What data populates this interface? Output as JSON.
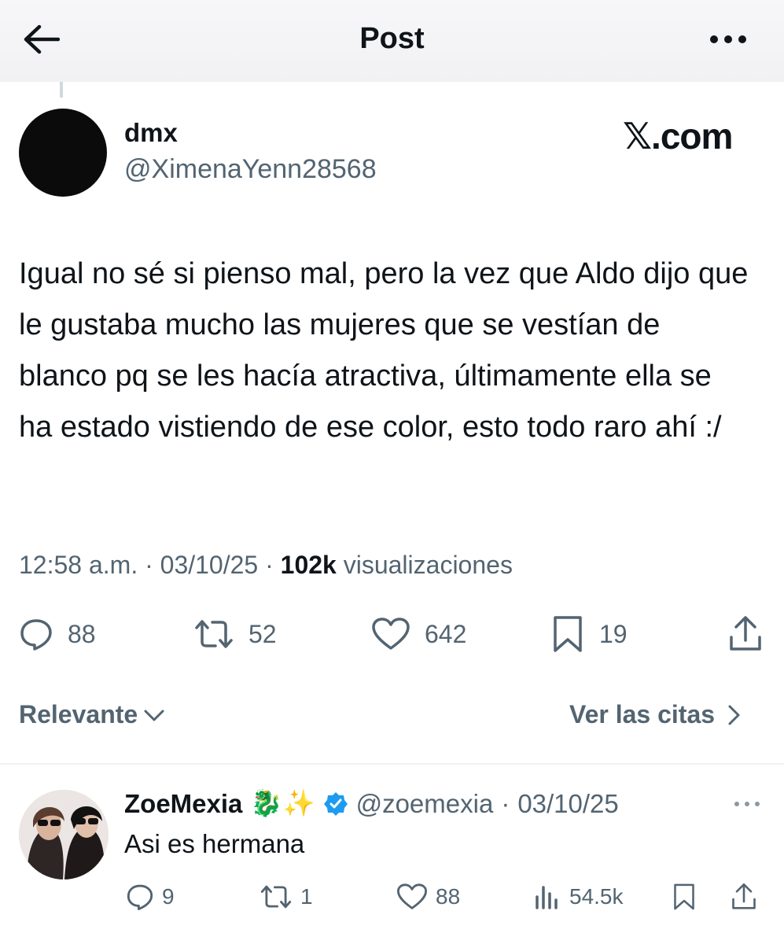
{
  "header": {
    "title": "Post",
    "back_icon": "back-arrow-icon",
    "more_icon": "more-horizontal-icon"
  },
  "post": {
    "author_name": "dmx",
    "author_handle": "@XimenaYenn28568",
    "brand": "𝕏.com",
    "text": "Igual no sé si pienso mal, pero la vez que Aldo dijo que le gustaba mucho las mujeres que se vestían de blanco pq se les hacía atractiva, últimamente ella se ha estado vistiendo de ese color, esto todo raro ahí :/",
    "time": "12:58 a.m.",
    "date": "03/10/25",
    "views_count": "102k",
    "views_label": "visualizaciones",
    "separator": "·",
    "replies": "88",
    "reposts": "52",
    "likes": "642",
    "bookmarks": "19"
  },
  "sort": {
    "label": "Relevante",
    "quotes_label": "Ver las citas"
  },
  "reply": {
    "name": "ZoeMexia",
    "emoji": "🐉✨",
    "handle": "@zoemexia",
    "separator": "·",
    "date": "03/10/25",
    "text": "Asi es hermana",
    "replies": "9",
    "reposts": "1",
    "likes": "88",
    "views": "54.5k"
  },
  "colors": {
    "text": "#0f1419",
    "secondary": "#536471",
    "verified": "#1d9bf0",
    "divider": "#eff3f4"
  }
}
